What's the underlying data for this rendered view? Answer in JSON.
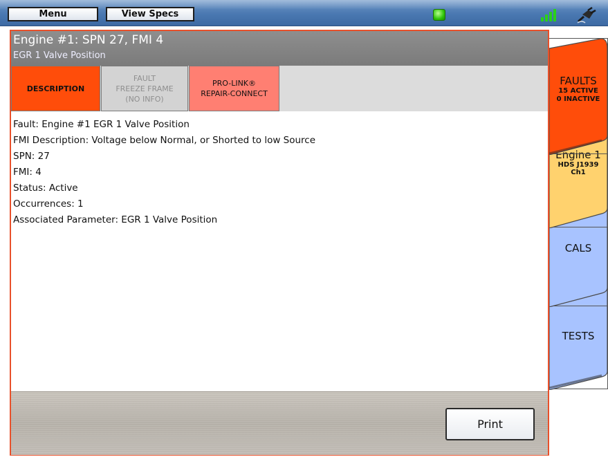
{
  "toolbar": {
    "menu_label": "Menu",
    "view_specs_label": "View Specs",
    "status_led_color": "#2fc40a",
    "signal_icon": "signal-bars-icon",
    "connection_icon": "plug-icon"
  },
  "header": {
    "title": "Engine #1: SPN 27, FMI 4",
    "subtitle": "EGR 1 Valve Position"
  },
  "tabs": [
    {
      "lines": [
        "DESCRIPTION"
      ],
      "state": "active"
    },
    {
      "lines": [
        "FAULT",
        "FREEZE FRAME",
        "(NO INFO)"
      ],
      "state": "disabled"
    },
    {
      "lines": [
        "PRO-LINK®",
        "REPAIR-CONNECT"
      ],
      "state": "normal"
    }
  ],
  "details": [
    "Fault: Engine #1 EGR 1 Valve Position",
    "FMI Description: Voltage below Normal, or Shorted to low Source",
    "SPN: 27",
    "FMI: 4",
    "Status: Active",
    "Occurrences: 1",
    "Associated Parameter: EGR 1 Valve Position"
  ],
  "footer": {
    "print_label": "Print"
  },
  "side_tabs": {
    "faults": {
      "title": "FAULTS",
      "line1": "15 ACTIVE",
      "line2": "0 INACTIVE",
      "color": "#ff4d0a"
    },
    "engine": {
      "title": "Engine 1",
      "line1": "HDS J1939",
      "line2": "Ch1",
      "color": "#ffd26e"
    },
    "cals": {
      "title": "CALS",
      "color": "#a8c3ff"
    },
    "tests": {
      "title": "TESTS",
      "color": "#a8c3ff"
    }
  },
  "colors": {
    "accent_border": "#e8502a",
    "title_bar": "#858585"
  }
}
